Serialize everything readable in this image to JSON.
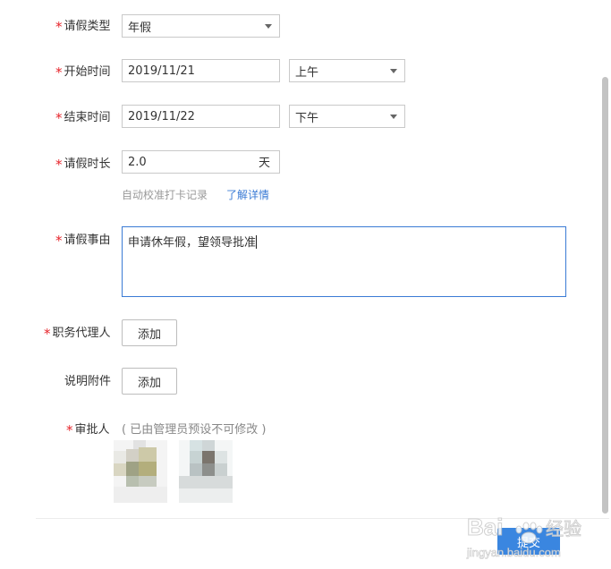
{
  "form": {
    "leave_type": {
      "label": "请假类型",
      "value": "年假"
    },
    "start_time": {
      "label": "开始时间",
      "date": "2019/11/21",
      "period": "上午"
    },
    "end_time": {
      "label": "结束时间",
      "date": "2019/11/22",
      "period": "下午"
    },
    "duration": {
      "label": "请假时长",
      "value": "2.0",
      "unit": "天"
    },
    "duration_hint": {
      "text": "自动校准打卡记录",
      "link": "了解详情"
    },
    "reason": {
      "label": "请假事由",
      "value": "申请休年假，望领导批准"
    },
    "delegate": {
      "label": "职务代理人",
      "button": "添加"
    },
    "attachment": {
      "label": "说明附件",
      "button": "添加"
    },
    "approver": {
      "label": "审批人",
      "note": "( 已由管理员预设不可修改 )"
    }
  },
  "required_mark": "*",
  "footer": {
    "submit_label": "提交"
  },
  "watermark": {
    "brand": "Bai",
    "brand_cn": "经验",
    "url": "jingyan.baidu.com"
  },
  "colors": {
    "required": "#e6242b",
    "accent": "#3a7bd5",
    "submit_bg": "#3a86e0",
    "border": "#c9c9c9",
    "muted": "#999999"
  }
}
